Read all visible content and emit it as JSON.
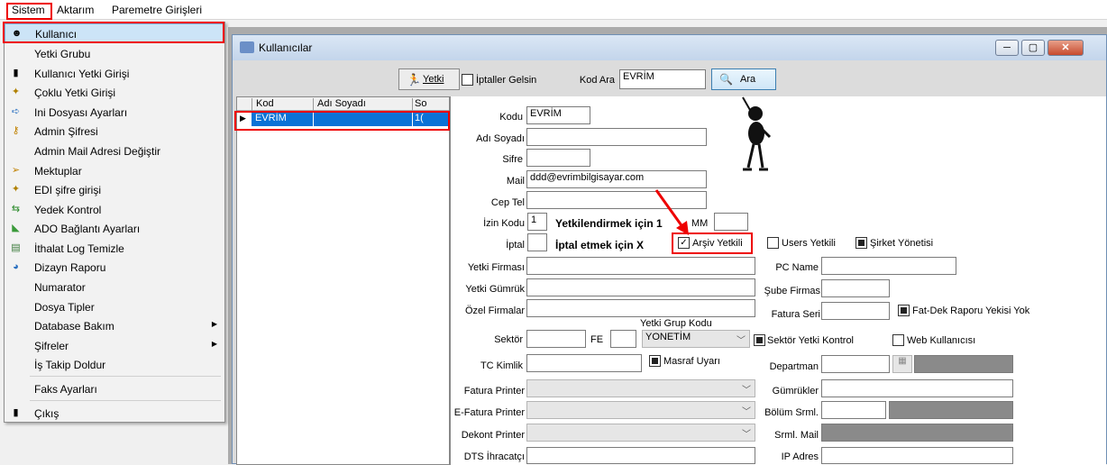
{
  "menubar": {
    "sistem": "Sistem",
    "aktarim": "Aktarım",
    "parametre": "Paremetre Girişleri"
  },
  "menu_items": [
    {
      "label": "Kullanıcı",
      "icon": "user-face-icon"
    },
    {
      "label": "Yetki Grubu",
      "icon": ""
    },
    {
      "label": "Kullanıcı Yetki Girişi",
      "icon": "user-key-icon"
    },
    {
      "label": "Çoklu Yetki Girişi",
      "icon": "multi-key-icon"
    },
    {
      "label": "Ini Dosyası  Ayarları",
      "icon": "ini-file-icon"
    },
    {
      "label": "Admin Şifresi",
      "icon": "admin-key-icon"
    },
    {
      "label": "Admin Mail Adresi Değiştir",
      "icon": ""
    },
    {
      "label": "Mektuplar",
      "icon": "letters-icon"
    },
    {
      "label": "EDI şifre girişi",
      "icon": "edi-key-icon"
    },
    {
      "label": "Yedek Kontrol",
      "icon": "backup-icon"
    },
    {
      "label": "ADO Bağlantı Ayarları",
      "icon": "ado-connection-icon"
    },
    {
      "label": "İthalat Log Temizle",
      "icon": "log-clean-icon"
    },
    {
      "label": "Dizayn Raporu",
      "icon": "design-report-icon"
    },
    {
      "label": "Numarator",
      "icon": ""
    },
    {
      "label": "Dosya Tipler",
      "icon": ""
    },
    {
      "label": "Database Bakım",
      "icon": ""
    },
    {
      "label": "Şifreler",
      "icon": ""
    },
    {
      "label": "İş Takip Doldur",
      "icon": ""
    },
    {
      "label": "Faks Ayarları",
      "icon": ""
    },
    {
      "label": "Çıkış",
      "icon": "exit-icon"
    }
  ],
  "window": {
    "title": "Kullanıcılar"
  },
  "toolbar": {
    "yetki": "Yetki",
    "iptaller": "İptaller Gelsin",
    "kod_ara_label": "Kod Ara",
    "kod_ara_value": "EVRİM",
    "ara": "Ara"
  },
  "grid": {
    "col_kod": "Kod",
    "col_adi": "Adı Soyadı",
    "col_so": "So",
    "row_kod": "EVRİM",
    "row_so": "1("
  },
  "form": {
    "kodu_label": "Kodu",
    "kodu_value": "EVRİM",
    "adi_label": "Adı Soyadı",
    "sifre_label": "Sifre",
    "mail_label": "Mail",
    "mail_value": "ddd@evrimbilgisayar.com",
    "cep_label": "Cep Tel",
    "izin_label": "İzin Kodu",
    "izin_value": "1",
    "yetki_note": "Yetkilendirmek için 1",
    "mm_label": "MM",
    "iptal_label": "İptal",
    "iptal_note": "İptal etmek için X",
    "arsiv": "Arşiv Yetkili",
    "users": "Users Yetkili",
    "sirket": "Şirket Yönetisi",
    "yetki_firmasi": "Yetki Firması",
    "pc_name": "PC Name",
    "yetki_gumruk": "Yetki Gümrük",
    "sube": "Şube Firmas",
    "ozel": "Özel Firmalar",
    "fatura_seri": "Fatura Seri",
    "fatdek": "Fat-Dek Raporu Yekisi Yok",
    "grup_kodu_label": "Yetki Grup Kodu",
    "grup_kodu_value": "YONETİM",
    "sektor": "Sektör",
    "fe": "FE",
    "sektor_yetki": "Sektör Yetki Kontrol",
    "web": "Web Kullanıcısı",
    "tc": "TC Kimlik",
    "masraf": "Masraf Uyarı",
    "departman": "Departman",
    "fatura_printer": "Fatura Printer",
    "gumrukler": "Gümrükler",
    "efatura_printer": "E-Fatura Printer",
    "bolum": "Bölüm Srml.",
    "dekont_printer": "Dekont Printer",
    "srml_mail": "Srml. Mail",
    "dts": "DTS İhracatçı",
    "ip": "IP Adres"
  },
  "colors": {
    "highlight": "#3399ff",
    "annotation": "#e00000",
    "title_bar": "#c3d5eb"
  }
}
